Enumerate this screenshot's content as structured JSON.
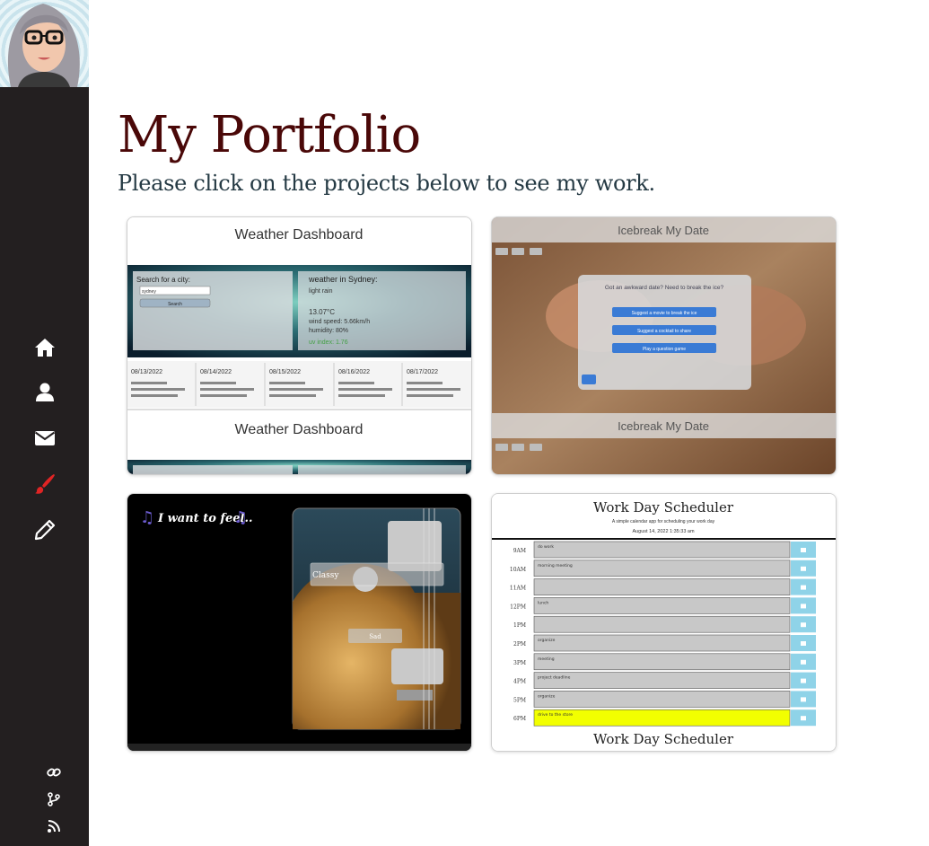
{
  "page": {
    "title": "My Portfolio",
    "subtitle": "Please click on the projects below to see my work."
  },
  "sidebar": {
    "nav": [
      {
        "icon": "home-icon",
        "color": "#ffffff",
        "active": false
      },
      {
        "icon": "user-icon",
        "color": "#ffffff",
        "active": false
      },
      {
        "icon": "envelope-icon",
        "color": "#ffffff",
        "active": false
      },
      {
        "icon": "paintbrush-icon",
        "color": "#e02424",
        "active": true
      },
      {
        "icon": "pencil-icon",
        "color": "#ffffff",
        "active": false
      }
    ],
    "social": [
      "link-icon",
      "git-branch-icon",
      "blog-icon"
    ]
  },
  "projects": {
    "weather": {
      "heading": "Weather Dashboard",
      "search_label": "Search for a city:",
      "city_value": "sydney",
      "search_button": "Search",
      "weather_title": "weather in Sydney:",
      "line1": "light rain",
      "temp": "13.07°C",
      "wind": "wind speed: 5.66km/h",
      "humidity": "humidity: 80%",
      "uv": "uv index: 1.76",
      "days": [
        "08/13/2022",
        "08/14/2022",
        "08/15/2022",
        "08/16/2022",
        "08/17/2022"
      ],
      "repeat_heading": "Weather Dashboard"
    },
    "icebreak": {
      "heading": "Icebreak My Date",
      "modal_title": "Got an awkward date? Need to break the ice?",
      "btn1": "Suggest a movie to break the ice",
      "btn2": "Suggest a cocktail to share",
      "btn3": "Play a question game",
      "repeat_heading": "Icebreak My Date"
    },
    "mood": {
      "heading": "I want to feel..",
      "option1": "Classy",
      "option2": "Sad"
    },
    "scheduler": {
      "heading": "Work Day Scheduler",
      "subheading": "A simple calendar app for scheduling your work day",
      "date": "August 14, 2022 1:35:33 am",
      "hours": [
        "9AM",
        "10AM",
        "11AM",
        "12PM",
        "1PM",
        "2PM",
        "3PM",
        "4PM",
        "5PM",
        "6PM"
      ],
      "entries": [
        "do work",
        "morning meeting",
        "",
        "lunch",
        "",
        "organize",
        "meeting",
        "project deadline",
        "organize",
        "drive to the store"
      ],
      "repeat_heading": "Work Day Scheduler"
    }
  }
}
